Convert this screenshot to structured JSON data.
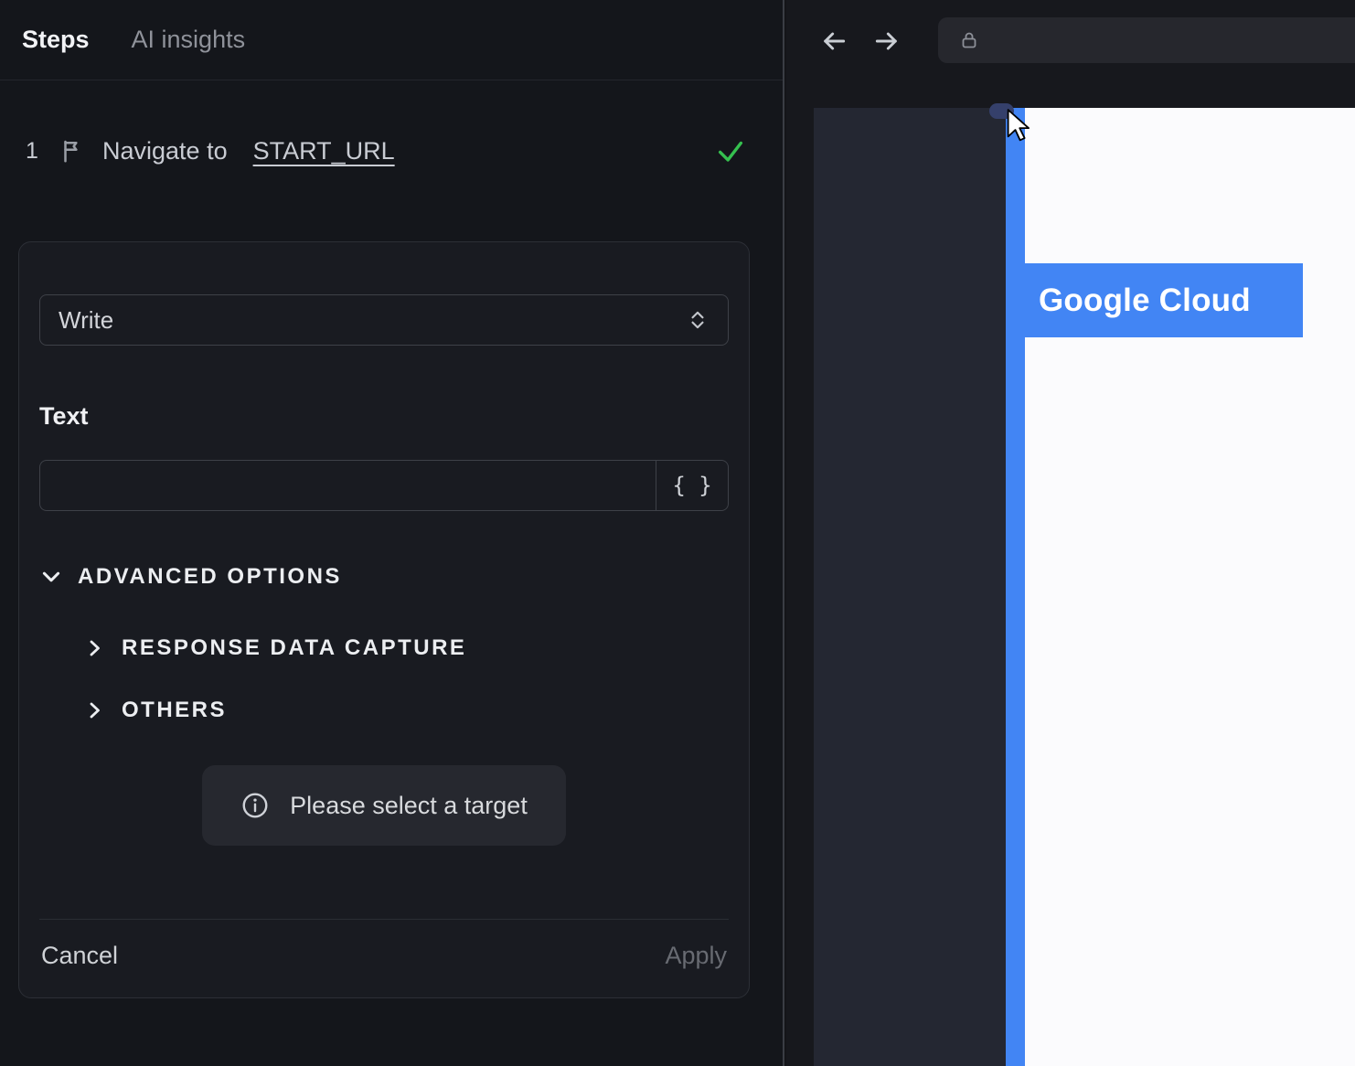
{
  "colors": {
    "accent_blue": "#4285f4",
    "success_green": "#35c04f"
  },
  "left_panel": {
    "tabs": [
      {
        "label": "Steps"
      },
      {
        "label": "AI insights"
      }
    ],
    "step": {
      "number": "1",
      "icon": "flag-icon",
      "text": "Navigate to",
      "link": "START_URL",
      "status_icon": "check-icon"
    },
    "editor": {
      "action_select_value": "Write",
      "text_label": "Text",
      "text_value": "",
      "braces_label": "{ }",
      "advanced_options": "ADVANCED OPTIONS",
      "response_data_capture": "RESPONSE DATA CAPTURE",
      "others": "OTHERS",
      "target_hint": "Please select a target",
      "cancel_label": "Cancel",
      "apply_label": "Apply"
    }
  },
  "browser": {
    "url_value": "",
    "lock_icon": "lock-icon",
    "viewport": {
      "highlight_label": "Google Cloud"
    }
  }
}
